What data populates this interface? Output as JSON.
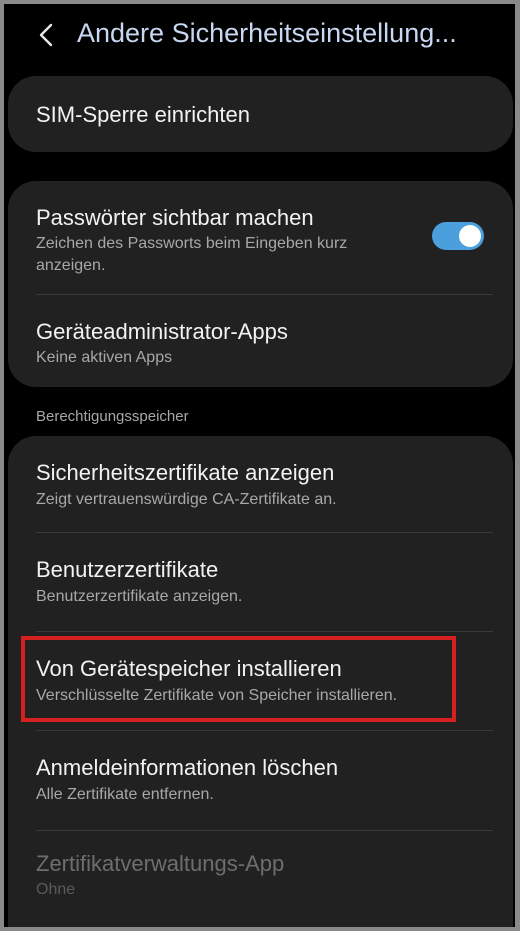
{
  "header": {
    "title": "Andere Sicherheitseinstellung..."
  },
  "sim": {
    "title": "SIM-Sperre einrichten"
  },
  "group1": {
    "password": {
      "title": "Passwörter sichtbar machen",
      "sub": "Zeichen des Passworts beim Eingeben kurz anzeigen.",
      "toggle_on": true
    },
    "admin": {
      "title": "Geräteadministrator-Apps",
      "sub": "Keine aktiven Apps"
    }
  },
  "section_label": "Berechtigungsspeicher",
  "group2": {
    "items": [
      {
        "title": "Sicherheitszertifikate anzeigen",
        "sub": "Zeigt vertrauenswürdige CA-Zertifikate an."
      },
      {
        "title": "Benutzerzertifikate",
        "sub": "Benutzerzertifikate anzeigen."
      },
      {
        "title": "Von Gerätespeicher installieren",
        "sub": "Verschlüsselte Zertifikate von Speicher installieren."
      },
      {
        "title": "Anmeldeinformationen löschen",
        "sub": "Alle Zertifikate entfernen."
      },
      {
        "title": "Zertifikatverwaltungs-App",
        "sub": "Ohne"
      }
    ]
  },
  "colors": {
    "accent": "#4a9fdc",
    "highlight": "#d61f1f",
    "title": "#c8d7f2",
    "card": "#212121"
  }
}
